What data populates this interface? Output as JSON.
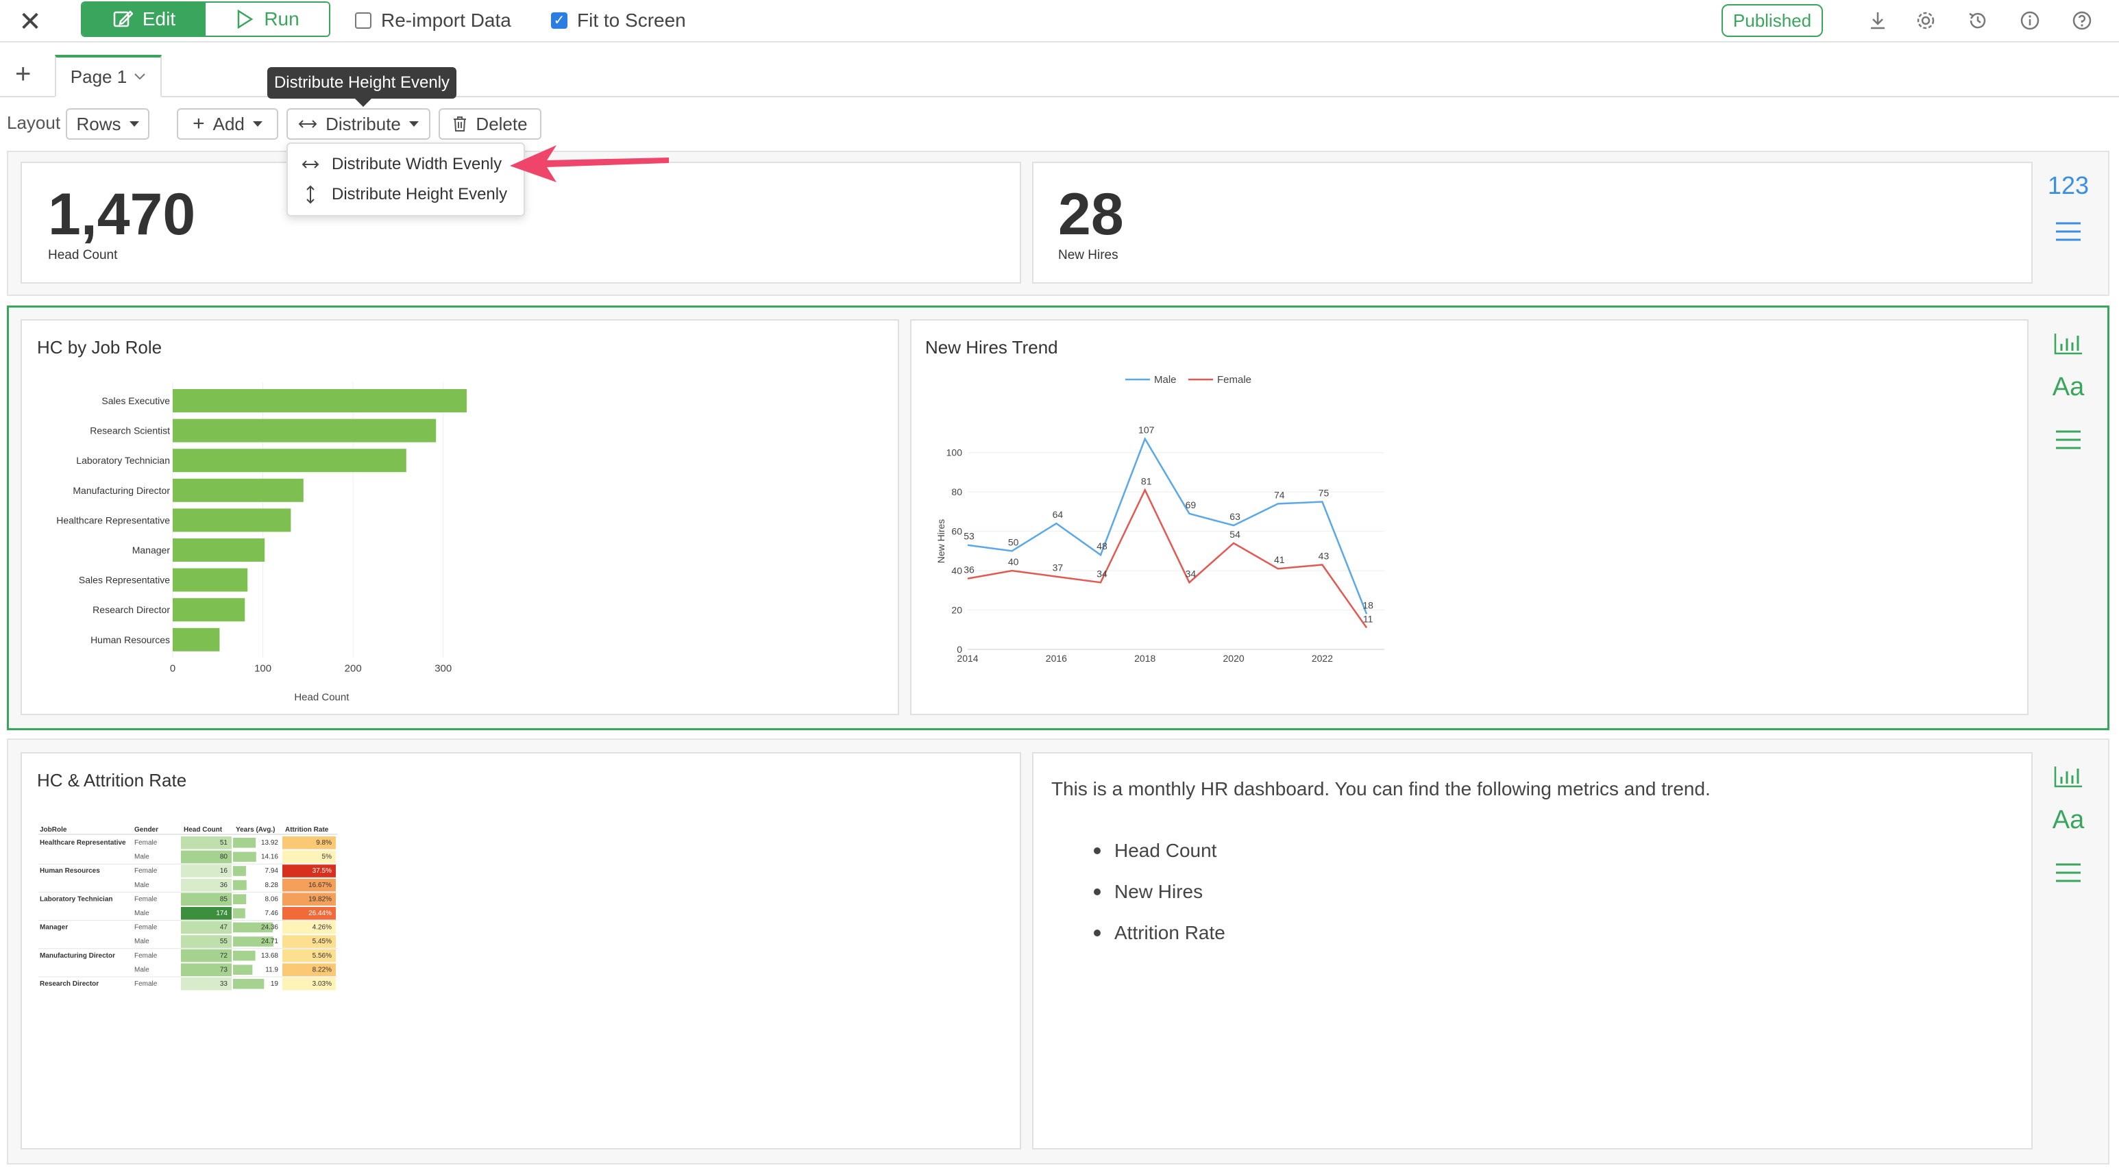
{
  "toolbar": {
    "edit_label": "Edit",
    "run_label": "Run",
    "reimport_label": "Re-import Data",
    "reimport_checked": false,
    "fit_label": "Fit to Screen",
    "fit_checked": true,
    "published_label": "Published",
    "accent_color": "#3aa55d"
  },
  "tabs": {
    "page_tab_label": "Page 1"
  },
  "tooltip": "Distribute Height Evenly",
  "layout_bar": {
    "layout_label": "Layout",
    "rows_label": "Rows",
    "add_label": "Add",
    "distribute_label": "Distribute",
    "delete_label": "Delete"
  },
  "distribute_menu": [
    {
      "label": "Distribute Width Evenly",
      "icon": "horizontal-arrows-icon"
    },
    {
      "label": "Distribute Height Evenly",
      "icon": "vertical-arrows-icon"
    }
  ],
  "kpis": [
    {
      "value": "1,470",
      "label": "Head Count"
    },
    {
      "value": "28",
      "label": "New Hires"
    }
  ],
  "kpi_side_icon_text": "123",
  "charts_row": {
    "bar_title": "HC by Job Role",
    "line_title": "New Hires Trend"
  },
  "chart_data": [
    {
      "type": "bar",
      "orientation": "horizontal",
      "title": "HC by Job Role",
      "categories": [
        "Sales Executive",
        "Research Scientist",
        "Laboratory Technician",
        "Manufacturing Director",
        "Healthcare Representative",
        "Manager",
        "Sales Representative",
        "Research Director",
        "Human Resources"
      ],
      "values": [
        326,
        292,
        259,
        145,
        131,
        102,
        83,
        80,
        52
      ],
      "xlabel": "Head Count",
      "xticks": [
        "0",
        "100",
        "200",
        "300"
      ],
      "xlim": [
        0,
        380
      ],
      "color": "#7dbf50"
    },
    {
      "type": "line",
      "title": "New Hires Trend",
      "ylabel": "New Hires",
      "x": [
        2014,
        2015,
        2016,
        2017,
        2018,
        2019,
        2020,
        2021,
        2022,
        2023
      ],
      "xticks": [
        "2014",
        "2016",
        "2018",
        "2020",
        "2022"
      ],
      "yticks": [
        "0",
        "20",
        "40",
        "60",
        "80",
        "100"
      ],
      "ylim": [
        0,
        110
      ],
      "legend_position": "top",
      "series": [
        {
          "name": "Male",
          "color": "#5aa8e8",
          "values": [
            53,
            50,
            64,
            48,
            107,
            69,
            63,
            74,
            75,
            18
          ]
        },
        {
          "name": "Female",
          "color": "#e05a52",
          "values": [
            36,
            40,
            37,
            34,
            81,
            34,
            54,
            41,
            43,
            11
          ]
        }
      ]
    },
    {
      "type": "table",
      "title": "HC & Attrition Rate",
      "columns": [
        "JobRole",
        "Gender",
        "Head Count",
        "Years (Avg.)",
        "Attrition Rate"
      ],
      "rows": [
        [
          "Healthcare Representative",
          "Female",
          "51",
          "13.92",
          "9.8%"
        ],
        [
          "",
          "Male",
          "80",
          "14.16",
          "5%"
        ],
        [
          "Human Resources",
          "Female",
          "16",
          "7.94",
          "37.5%"
        ],
        [
          "",
          "Male",
          "36",
          "8.28",
          "16.67%"
        ],
        [
          "Laboratory Technician",
          "Female",
          "85",
          "8.06",
          "19.82%"
        ],
        [
          "",
          "Male",
          "174",
          "7.46",
          "26.44%"
        ],
        [
          "Manager",
          "Female",
          "47",
          "24.36",
          "4.26%"
        ],
        [
          "",
          "Male",
          "55",
          "24.71",
          "5.45%"
        ],
        [
          "Manufacturing Director",
          "Female",
          "72",
          "13.68",
          "5.56%"
        ],
        [
          "",
          "Male",
          "73",
          "11.9",
          "8.22%"
        ],
        [
          "Research Director",
          "Female",
          "33",
          "19",
          "3.03%"
        ]
      ]
    }
  ],
  "bottom_row": {
    "table_title": "HC & Attrition Rate",
    "description": "This is a monthly HR dashboard. You can find the following metrics and trend.",
    "bullets": [
      "Head Count",
      "New Hires",
      "Attrition Rate"
    ]
  }
}
